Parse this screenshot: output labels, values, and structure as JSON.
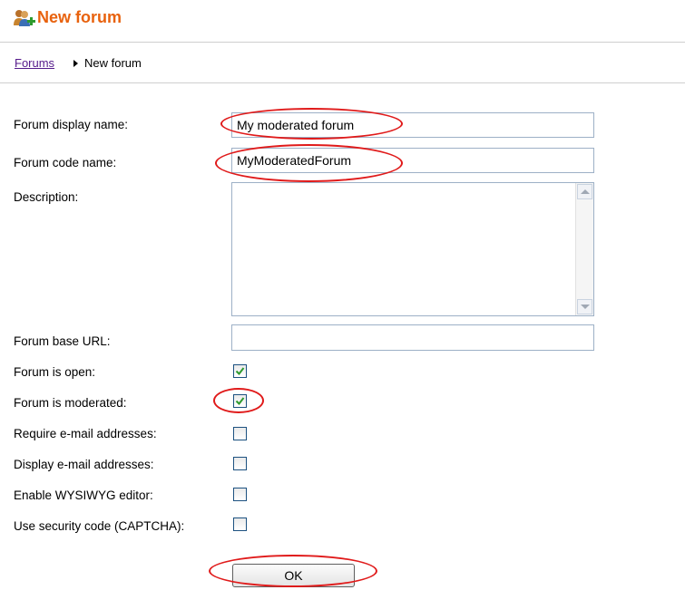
{
  "header": {
    "title": "New forum",
    "icon": "users-add-icon"
  },
  "breadcrumb": {
    "parent": "Forums",
    "current": "New forum"
  },
  "form": {
    "display_name_label": "Forum display name:",
    "display_name_value": "My moderated forum",
    "code_name_label": "Forum code name:",
    "code_name_value": "MyModeratedForum",
    "description_label": "Description:",
    "description_value": "",
    "base_url_label": "Forum base URL:",
    "base_url_value": "",
    "checkboxes": [
      {
        "label": "Forum is open:",
        "checked": true
      },
      {
        "label": "Forum is moderated:",
        "checked": true
      },
      {
        "label": "Require e-mail addresses:",
        "checked": false
      },
      {
        "label": "Display e-mail addresses:",
        "checked": false
      },
      {
        "label": "Enable WYSIWYG editor:",
        "checked": false
      },
      {
        "label": "Use security code (CAPTCHA):",
        "checked": false
      }
    ],
    "ok_label": "OK"
  },
  "colors": {
    "title": "#e8620e",
    "link": "#551a8b",
    "annotation": "#e01a1a",
    "checkmark": "#2e9a2e"
  }
}
